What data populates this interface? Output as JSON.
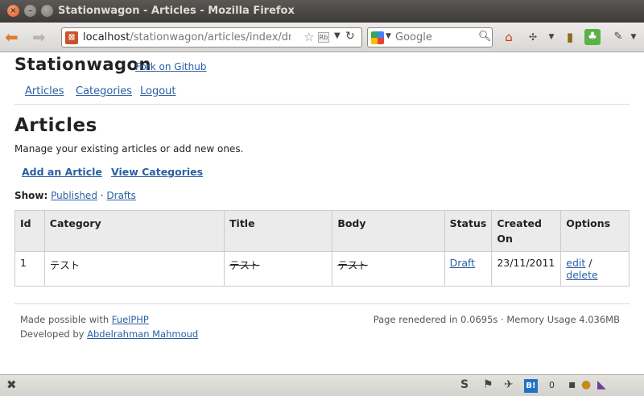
{
  "window": {
    "title": "Stationwagon - Articles - Mozilla Firefox"
  },
  "browser": {
    "url_host": "localhost",
    "url_path": "/stationwagon/articles/index/dr",
    "search_placeholder": "Google",
    "icons": {
      "back": "back-arrow-icon",
      "forward": "forward-arrow-icon",
      "favicon": "xampp-favicon",
      "bookmark": "star-icon",
      "reload": "reload-icon",
      "search_engine": "google-icon",
      "search": "magnifier-icon",
      "home": "home-icon"
    }
  },
  "site": {
    "brand": "Stationwagon",
    "fork_link": "Fork on Github",
    "nav": [
      "Articles",
      "Categories",
      "Logout"
    ]
  },
  "page": {
    "heading": "Articles",
    "lead": "Manage your existing articles or add new ones.",
    "actions": [
      "Add an Article",
      "View Categories"
    ],
    "show_label": "Show:",
    "filters": [
      "Published",
      "Drafts"
    ],
    "filter_separator": " · "
  },
  "table": {
    "headers": [
      "Id",
      "Category",
      "Title",
      "Body",
      "Status",
      "Created On",
      "Options"
    ],
    "rows": [
      {
        "id": "1",
        "category": "テスト",
        "title": "テスト",
        "body": "テスト",
        "status": "Draft",
        "created_on": "23/11/2011",
        "edit": "edit",
        "sep": "/",
        "delete": "delete"
      }
    ]
  },
  "footer": {
    "made_prefix": "Made possible with ",
    "made_link": "FuelPHP",
    "dev_prefix": "Developed by ",
    "dev_link": "Abdelrahman Mahmoud",
    "stats": "Page renedered in 0.0695s · Memory Usage 4.036MB"
  },
  "statusbar": {
    "count": "0"
  },
  "colors": {
    "link": "#2a5fa4",
    "titlebar": "#3c3b37",
    "table_header": "#ebebeb"
  }
}
